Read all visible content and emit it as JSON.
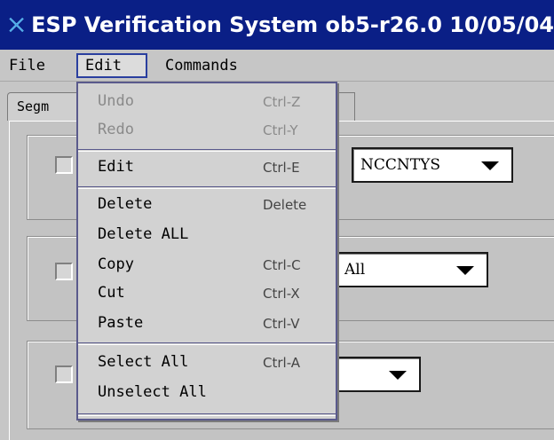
{
  "window": {
    "title": "ESP Verification System ob5-r26.0 10/05/04",
    "icon": "x-close-icon",
    "titlebar_color": "#0a1f86"
  },
  "menubar": {
    "items": [
      {
        "label": "File"
      },
      {
        "label": "Edit"
      },
      {
        "label": "Commands"
      }
    ]
  },
  "tabs": [
    {
      "label": "Segm"
    }
  ],
  "groups": [
    {
      "combo_value": "NCCNTYS"
    },
    {
      "combo_value": "All"
    },
    {
      "combo_value": ""
    }
  ],
  "edit_menu": {
    "items": [
      {
        "label": "Undo",
        "accelerator": "Ctrl-Z",
        "enabled": false
      },
      {
        "label": "Redo",
        "accelerator": "Ctrl-Y",
        "enabled": false
      },
      {
        "label": "Edit",
        "accelerator": "Ctrl-E",
        "enabled": true
      },
      {
        "label": "Delete",
        "accelerator": "Delete",
        "enabled": true
      },
      {
        "label": "Delete ALL",
        "accelerator": "",
        "enabled": true
      },
      {
        "label": "Copy",
        "accelerator": "Ctrl-C",
        "enabled": true
      },
      {
        "label": "Cut",
        "accelerator": "Ctrl-X",
        "enabled": true
      },
      {
        "label": "Paste",
        "accelerator": "Ctrl-V",
        "enabled": true
      },
      {
        "label": "Select All",
        "accelerator": "Ctrl-A",
        "enabled": true
      },
      {
        "label": "Unselect All",
        "accelerator": "",
        "enabled": true
      }
    ]
  }
}
